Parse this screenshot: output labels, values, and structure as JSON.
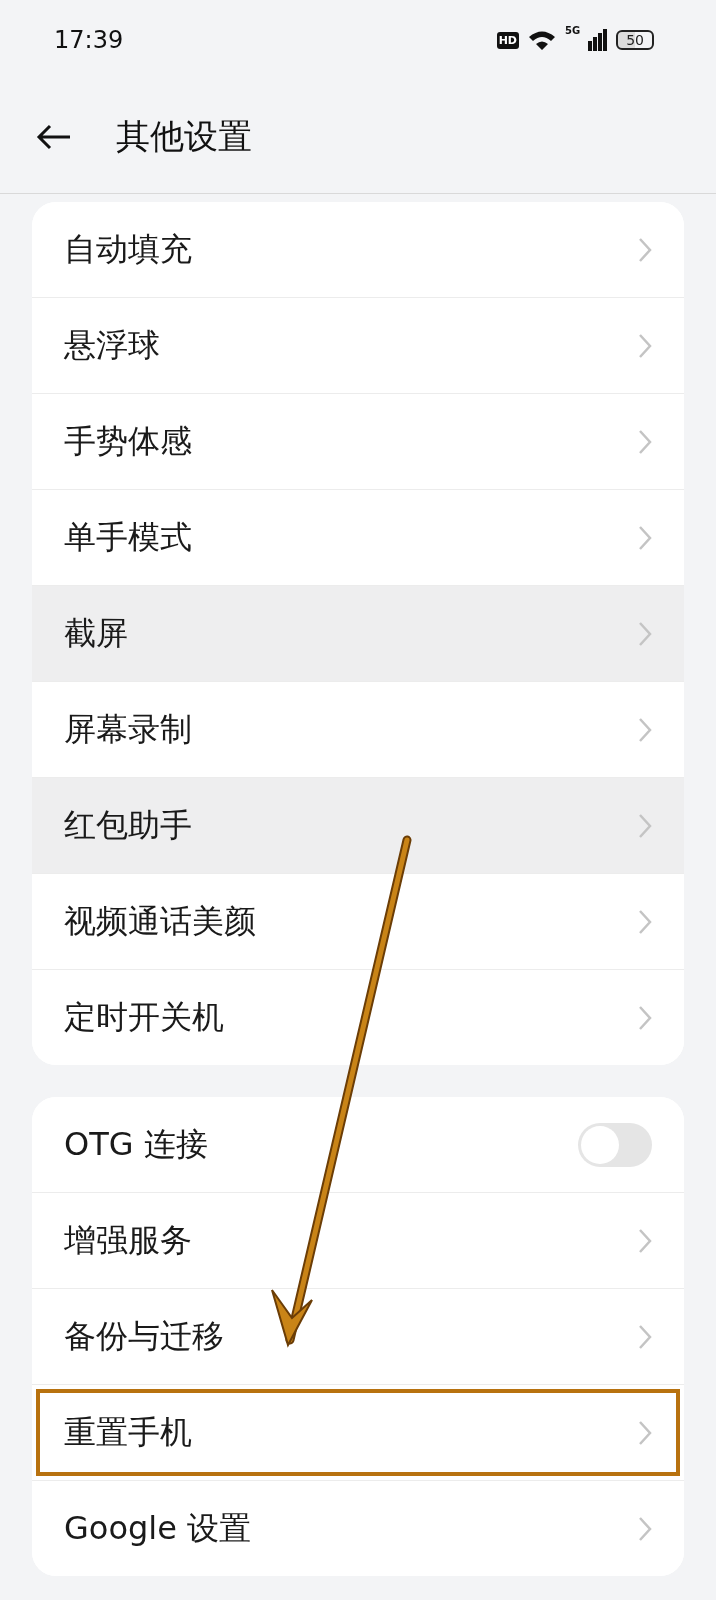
{
  "status_bar": {
    "time": "17:39",
    "hd_badge": "HD",
    "network": "5G",
    "battery": "50"
  },
  "header": {
    "title": "其他设置"
  },
  "groups": [
    {
      "rows": [
        {
          "kind": "link",
          "label": "自动填充",
          "highlighted": false,
          "outlined": false
        },
        {
          "kind": "link",
          "label": "悬浮球",
          "highlighted": false,
          "outlined": false
        },
        {
          "kind": "link",
          "label": "手势体感",
          "highlighted": false,
          "outlined": false
        },
        {
          "kind": "link",
          "label": "单手模式",
          "highlighted": false,
          "outlined": false
        },
        {
          "kind": "link",
          "label": "截屏",
          "highlighted": true,
          "outlined": false
        },
        {
          "kind": "link",
          "label": "屏幕录制",
          "highlighted": false,
          "outlined": false
        },
        {
          "kind": "link",
          "label": "红包助手",
          "highlighted": true,
          "outlined": false
        },
        {
          "kind": "link",
          "label": "视频通话美颜",
          "highlighted": false,
          "outlined": false
        },
        {
          "kind": "link",
          "label": "定时开关机",
          "highlighted": false,
          "outlined": false
        }
      ]
    },
    {
      "rows": [
        {
          "kind": "toggle",
          "label": "OTG 连接",
          "on": false,
          "highlighted": false,
          "outlined": false
        },
        {
          "kind": "link",
          "label": "增强服务",
          "highlighted": false,
          "outlined": false
        },
        {
          "kind": "link",
          "label": "备份与迁移",
          "highlighted": false,
          "outlined": false
        },
        {
          "kind": "link",
          "label": "重置手机",
          "highlighted": false,
          "outlined": true
        },
        {
          "kind": "link",
          "label": "Google 设置",
          "highlighted": false,
          "outlined": false
        }
      ]
    }
  ]
}
